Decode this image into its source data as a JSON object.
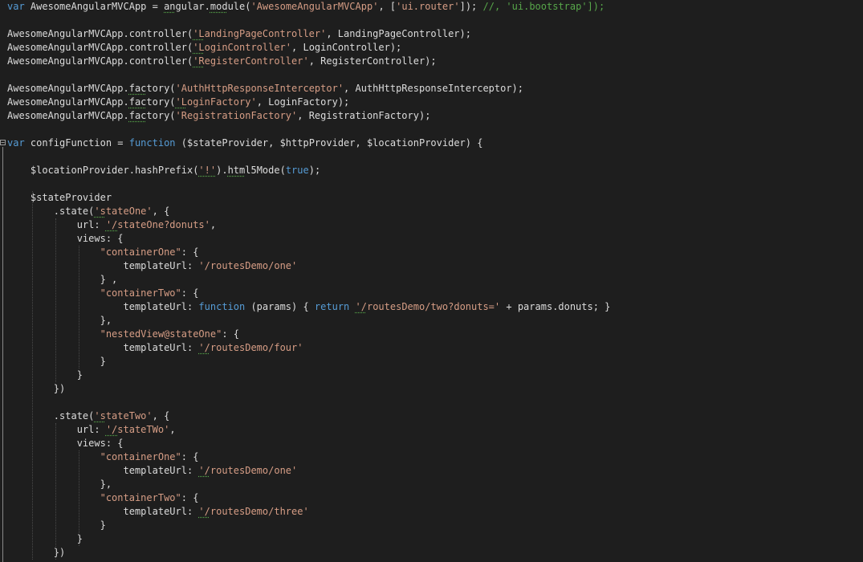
{
  "editor": {
    "colors": {
      "background": "#1e1e1e",
      "keyword": "#569cd6",
      "string": "#d69d85",
      "comment": "#57a64a",
      "plain": "#dcdcdc"
    },
    "lines": [
      [
        [
          "kw",
          "var"
        ],
        [
          "p",
          " AwesomeAngularMVCApp = "
        ],
        [
          "pu",
          "an"
        ],
        [
          "p",
          "gular."
        ],
        [
          "pu",
          "mod"
        ],
        [
          "p",
          "ule("
        ],
        [
          "s",
          "'AwesomeAngularMVCApp'"
        ],
        [
          "p",
          ", ["
        ],
        [
          "s",
          "'ui.router'"
        ],
        [
          "p",
          "]); "
        ],
        [
          "c",
          "//, 'ui.bootstrap']);"
        ]
      ],
      [],
      [
        [
          "p",
          "AwesomeAngularMVCApp.controller("
        ],
        [
          "su",
          "'L"
        ],
        [
          "s",
          "andingPageController'"
        ],
        [
          "p",
          ", LandingPageController);"
        ]
      ],
      [
        [
          "p",
          "AwesomeAngularMVCApp.controller("
        ],
        [
          "su",
          "'L"
        ],
        [
          "s",
          "oginController'"
        ],
        [
          "p",
          ", LoginController);"
        ]
      ],
      [
        [
          "p",
          "AwesomeAngularMVCApp.controller("
        ],
        [
          "su",
          "'R"
        ],
        [
          "s",
          "egisterController'"
        ],
        [
          "p",
          ", RegisterController);"
        ]
      ],
      [],
      [
        [
          "p",
          "AwesomeAngularMVCApp."
        ],
        [
          "pu",
          "fac"
        ],
        [
          "p",
          "tory("
        ],
        [
          "s",
          "'AuthHttpResponseInterceptor'"
        ],
        [
          "p",
          ", AuthHttpResponseInterceptor);"
        ]
      ],
      [
        [
          "p",
          "AwesomeAngularMVCApp."
        ],
        [
          "pu",
          "fac"
        ],
        [
          "p",
          "tory("
        ],
        [
          "su",
          "'L"
        ],
        [
          "s",
          "oginFactory'"
        ],
        [
          "p",
          ", LoginFactory);"
        ]
      ],
      [
        [
          "p",
          "AwesomeAngularMVCApp."
        ],
        [
          "pu",
          "fac"
        ],
        [
          "p",
          "tory("
        ],
        [
          "s",
          "'RegistrationFactory'"
        ],
        [
          "p",
          ", RegistrationFactory);"
        ]
      ],
      [],
      [
        [
          "kw",
          "var"
        ],
        [
          "p",
          " configFunction = "
        ],
        [
          "kw",
          "function"
        ],
        [
          "p",
          " ($stateProvider, $httpProvider, $locationProvider) {"
        ]
      ],
      [],
      [
        [
          "p",
          "    $locationProvider.hashPrefix("
        ],
        [
          "su",
          "'!'"
        ],
        [
          "p",
          ")."
        ],
        [
          "pu",
          "htm"
        ],
        [
          "p",
          "l5Mode("
        ],
        [
          "kw",
          "true"
        ],
        [
          "p",
          ");"
        ]
      ],
      [],
      [
        [
          "p",
          "    $stateProvider"
        ]
      ],
      [
        [
          "p",
          "        .state("
        ],
        [
          "su",
          "'s"
        ],
        [
          "s",
          "tateOne'"
        ],
        [
          "p",
          ", {"
        ]
      ],
      [
        [
          "p",
          "            url: "
        ],
        [
          "su",
          "'/"
        ],
        [
          "s",
          "stateOne?donuts'"
        ],
        [
          "p",
          ","
        ]
      ],
      [
        [
          "p",
          "            views: {"
        ]
      ],
      [
        [
          "p",
          "                "
        ],
        [
          "s",
          "\"containerOne\""
        ],
        [
          "p",
          ": {"
        ]
      ],
      [
        [
          "p",
          "                    templateUrl: "
        ],
        [
          "s",
          "'/routesDemo/one'"
        ]
      ],
      [
        [
          "p",
          "                } ,"
        ]
      ],
      [
        [
          "p",
          "                "
        ],
        [
          "s",
          "\"containerTwo\""
        ],
        [
          "p",
          ": {"
        ]
      ],
      [
        [
          "p",
          "                    templateUrl: "
        ],
        [
          "kw",
          "function"
        ],
        [
          "p",
          " (params) { "
        ],
        [
          "kw",
          "return"
        ],
        [
          "p",
          " "
        ],
        [
          "su",
          "'/"
        ],
        [
          "s",
          "routesDemo/two?donuts='"
        ],
        [
          "p",
          " + params.donuts; }"
        ]
      ],
      [
        [
          "p",
          "                },"
        ]
      ],
      [
        [
          "p",
          "                "
        ],
        [
          "s",
          "\"nestedView@stateOne\""
        ],
        [
          "p",
          ": {"
        ]
      ],
      [
        [
          "p",
          "                    templateUrl: "
        ],
        [
          "su",
          "'/"
        ],
        [
          "s",
          "routesDemo/four'"
        ]
      ],
      [
        [
          "p",
          "                }"
        ]
      ],
      [
        [
          "p",
          "            }"
        ]
      ],
      [
        [
          "p",
          "        })"
        ]
      ],
      [],
      [
        [
          "p",
          "        .state("
        ],
        [
          "su",
          "'s"
        ],
        [
          "s",
          "tateTwo'"
        ],
        [
          "p",
          ", {"
        ]
      ],
      [
        [
          "p",
          "            url: "
        ],
        [
          "su",
          "'/"
        ],
        [
          "s",
          "stateTWo'"
        ],
        [
          "p",
          ","
        ]
      ],
      [
        [
          "p",
          "            views: {"
        ]
      ],
      [
        [
          "p",
          "                "
        ],
        [
          "s",
          "\"containerOne\""
        ],
        [
          "p",
          ": {"
        ]
      ],
      [
        [
          "p",
          "                    templateUrl: "
        ],
        [
          "su",
          "'/"
        ],
        [
          "s",
          "routesDemo/one'"
        ]
      ],
      [
        [
          "p",
          "                },"
        ]
      ],
      [
        [
          "p",
          "                "
        ],
        [
          "s",
          "\"containerTwo\""
        ],
        [
          "p",
          ": {"
        ]
      ],
      [
        [
          "p",
          "                    templateUrl: "
        ],
        [
          "su",
          "'/"
        ],
        [
          "s",
          "routesDemo/three'"
        ]
      ],
      [
        [
          "p",
          "                }"
        ]
      ],
      [
        [
          "p",
          "            }"
        ]
      ],
      [
        [
          "p",
          "        })"
        ]
      ]
    ]
  }
}
